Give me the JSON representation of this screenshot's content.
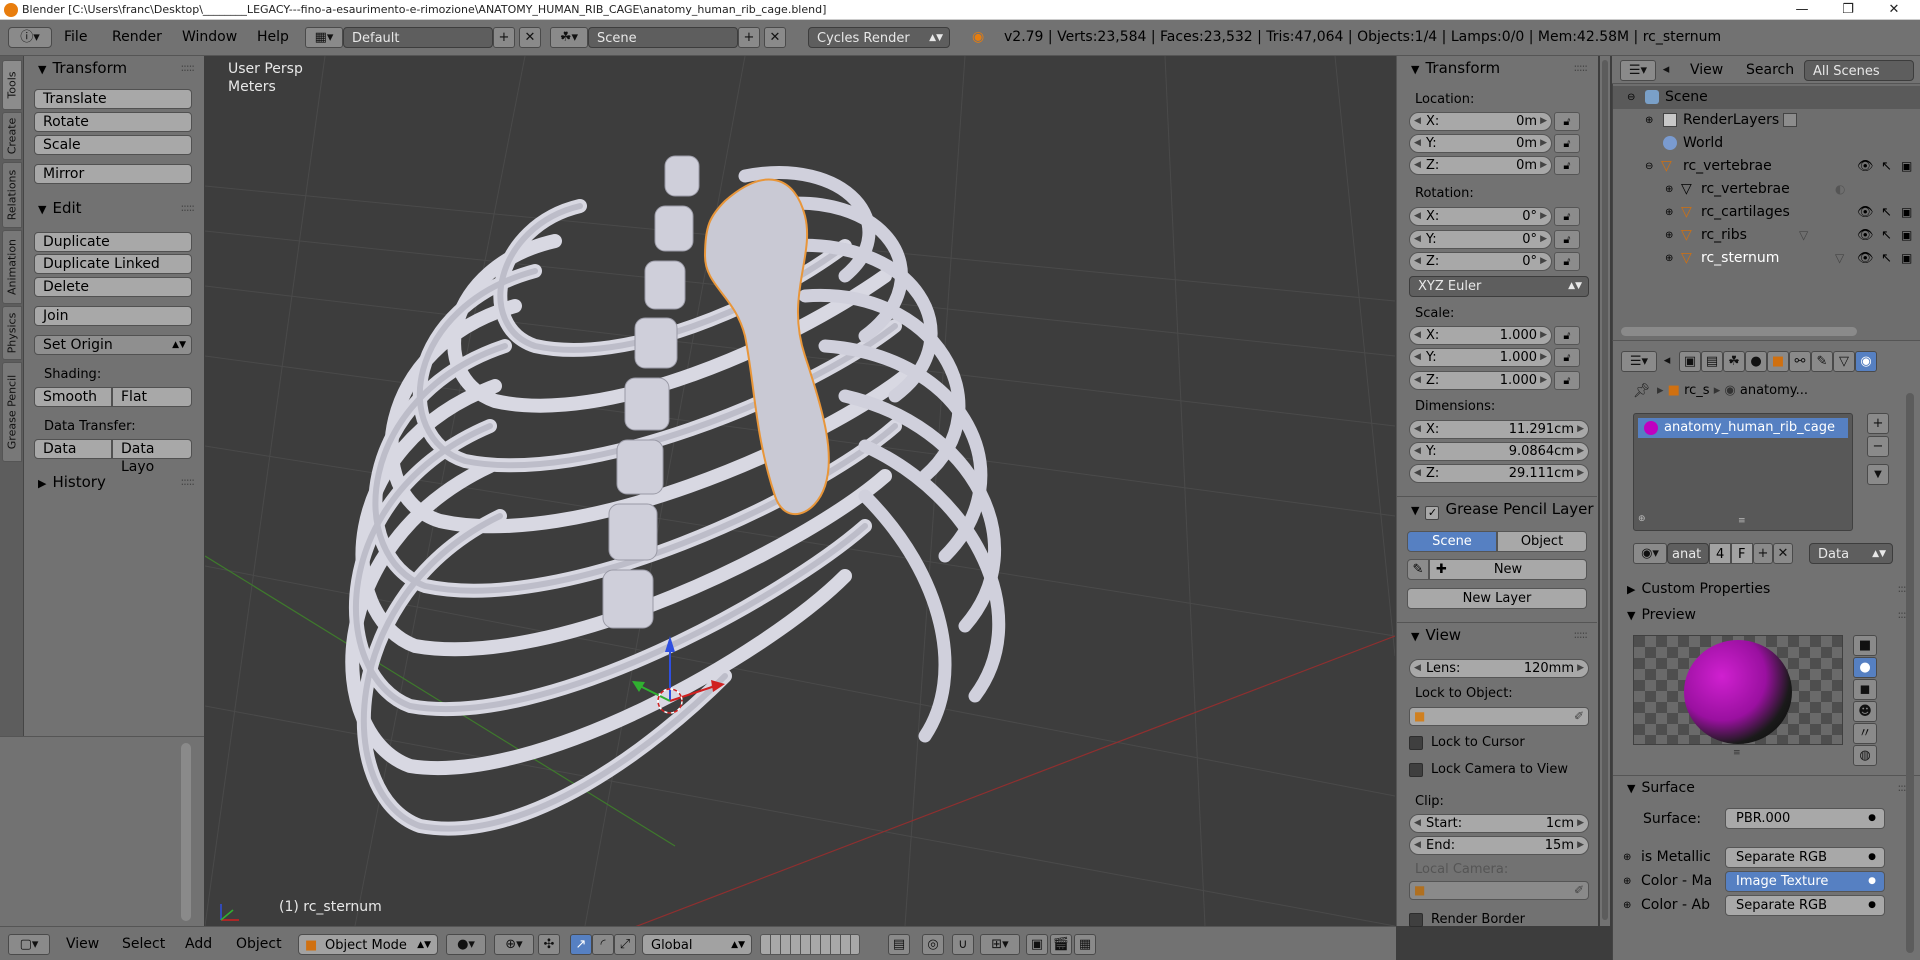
{
  "window": {
    "title": "Blender [C:\\Users\\franc\\Desktop\\________LEGACY---fino-a-esaurimento-e-rimozione\\ANATOMY_HUMAN_RIB_CAGE\\anatomy_human_rib_cage.blend]",
    "minimize": "—",
    "maximize": "❐",
    "close": "✕"
  },
  "header": {
    "menus": [
      "File",
      "Render",
      "Window",
      "Help"
    ],
    "screen_layout": "Default",
    "scene": "Scene",
    "render_engine": "Cycles Render",
    "stats": "v2.79 | Verts:23,584 | Faces:23,532 | Tris:47,064 | Objects:1/4 | Lamps:0/0 | Mem:42.58M | rc_sternum"
  },
  "tabs": [
    "Tools",
    "Create",
    "Relations",
    "Animation",
    "Physics",
    "Grease Pencil"
  ],
  "toolshelf": {
    "transform_title": "Transform",
    "translate": "Translate",
    "rotate": "Rotate",
    "scale": "Scale",
    "mirror": "Mirror",
    "edit_title": "Edit",
    "duplicate": "Duplicate",
    "duplicate_linked": "Duplicate Linked",
    "delete": "Delete",
    "join": "Join",
    "set_origin": "Set Origin",
    "shading_label": "Shading:",
    "smooth": "Smooth",
    "flat": "Flat",
    "data_transfer_label": "Data Transfer:",
    "data": "Data",
    "data_layout": "Data Layo",
    "history_title": "History"
  },
  "viewport": {
    "view_name": "User Persp",
    "units": "Meters",
    "object_label": "(1) rc_sternum"
  },
  "npanel": {
    "transform_title": "Transform",
    "location_label": "Location:",
    "location": [
      {
        "k": "X:",
        "v": "0m"
      },
      {
        "k": "Y:",
        "v": "0m"
      },
      {
        "k": "Z:",
        "v": "0m"
      }
    ],
    "rotation_label": "Rotation:",
    "rotation": [
      {
        "k": "X:",
        "v": "0°"
      },
      {
        "k": "Y:",
        "v": "0°"
      },
      {
        "k": "Z:",
        "v": "0°"
      }
    ],
    "rotation_mode": "XYZ Euler",
    "scale_label": "Scale:",
    "scale": [
      {
        "k": "X:",
        "v": "1.000"
      },
      {
        "k": "Y:",
        "v": "1.000"
      },
      {
        "k": "Z:",
        "v": "1.000"
      }
    ],
    "dimensions_label": "Dimensions:",
    "dimensions": [
      {
        "k": "X:",
        "v": "11.291cm"
      },
      {
        "k": "Y:",
        "v": "9.0864cm"
      },
      {
        "k": "Z:",
        "v": "29.111cm"
      }
    ],
    "gp_title": "Grease Pencil Layer",
    "gp_scene": "Scene",
    "gp_object": "Object",
    "gp_new": "New",
    "gp_new_layer": "New Layer",
    "view_title": "View",
    "lens_label": "Lens:",
    "lens_value": "120mm",
    "lock_object_label": "Lock to Object:",
    "lock_cursor": "Lock to Cursor",
    "lock_camera": "Lock Camera to View",
    "clip_label": "Clip:",
    "clip_start_k": "Start:",
    "clip_start_v": "1cm",
    "clip_end_k": "End:",
    "clip_end_v": "15m",
    "local_camera_label": "Local Camera:",
    "render_border": "Render Border"
  },
  "outliner": {
    "menus": [
      "View",
      "Search"
    ],
    "filter": "All Scenes",
    "items": [
      {
        "label": "Scene",
        "depth": 0
      },
      {
        "label": "RenderLayers",
        "depth": 1
      },
      {
        "label": "World",
        "depth": 1
      },
      {
        "label": "rc_vertebrae",
        "depth": 1
      },
      {
        "label": "rc_vertebrae",
        "depth": 2
      },
      {
        "label": "rc_cartilages",
        "depth": 2
      },
      {
        "label": "rc_ribs",
        "depth": 2
      },
      {
        "label": "rc_sternum",
        "depth": 2
      }
    ]
  },
  "properties": {
    "breadcrumb_obj": "rc_s",
    "breadcrumb_mat": "anatomy...",
    "material_slot": "anatomy_human_rib_cage",
    "mat_name": "anat",
    "mat_users": "4",
    "mat_fake": "F",
    "link": "Data",
    "custom_props": "Custom Properties",
    "preview_title": "Preview",
    "surface_title": "Surface",
    "surface_label": "Surface:",
    "surface_value": "PBR.000",
    "is_metallic_label": "is Metallic",
    "is_metallic_value": "Separate RGB",
    "color_ma_label": "Color - Ma",
    "color_ma_value": "Image Texture",
    "color_ab_label": "Color - Ab",
    "color_ab_value": "Separate RGB"
  },
  "bottombar": {
    "menus": [
      "View",
      "Select",
      "Add",
      "Object"
    ],
    "mode": "Object Mode",
    "orientation": "Global"
  }
}
